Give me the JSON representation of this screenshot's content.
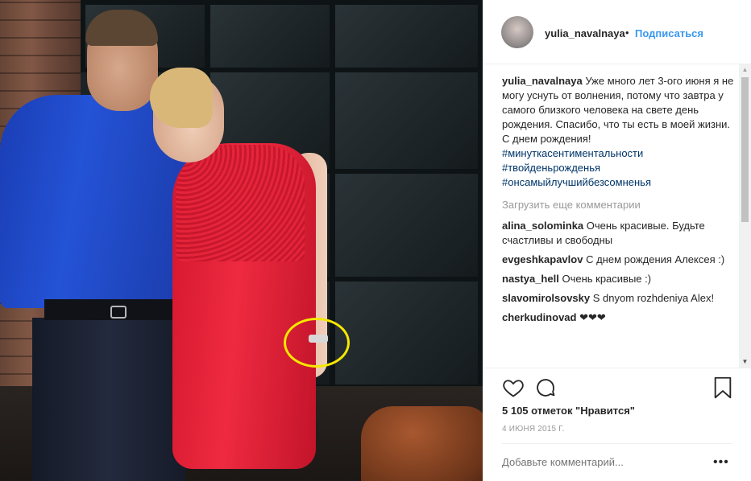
{
  "post": {
    "photo_alt": "",
    "highlight_color": "#f5e800"
  },
  "header": {
    "username": "yulia_navalnaya",
    "separator": "•",
    "follow_label": "Подписаться"
  },
  "caption": {
    "username": "yulia_navalnaya",
    "text": "Уже много лет 3-ого июня я не могу уснуть от волнения, потому что завтра у самого близкого человека на свете день рождения. Спасибо, что ты есть в моей жизни. С днем рождения!",
    "hashtags": [
      "#минуткасентиментальности",
      "#твойденьрожденья",
      "#онсамыйлучшийбезсомненья"
    ]
  },
  "load_more_label": "Загрузить еще комментарии",
  "comments": [
    {
      "username": "alina_solominka",
      "text": "Очень красивые. Будьте счастливы и свободны"
    },
    {
      "username": "evgeshkapavlov",
      "text": "С днем рождения Алексея :)"
    },
    {
      "username": "nastya_hell",
      "text": "Очень красивые :)"
    },
    {
      "username": "slavomirolsovsky",
      "text": "S dnyom rozhdeniya Alex!"
    },
    {
      "username": "cherkudinovad",
      "text": "❤❤❤"
    }
  ],
  "likes_text": "5 105 отметок \"Нравится\"",
  "date_text": "4 ИЮНЯ 2015 Г.",
  "add_comment_placeholder": "Добавьте комментарий...",
  "more_options": "•••",
  "colors": {
    "link_blue": "#3897f0",
    "hashtag": "#003569",
    "muted": "#999999"
  },
  "icons": {
    "like": "heart-icon",
    "comment": "comment-bubble-icon",
    "save": "bookmark-icon",
    "scroll_up": "▲",
    "scroll_down": "▼"
  }
}
